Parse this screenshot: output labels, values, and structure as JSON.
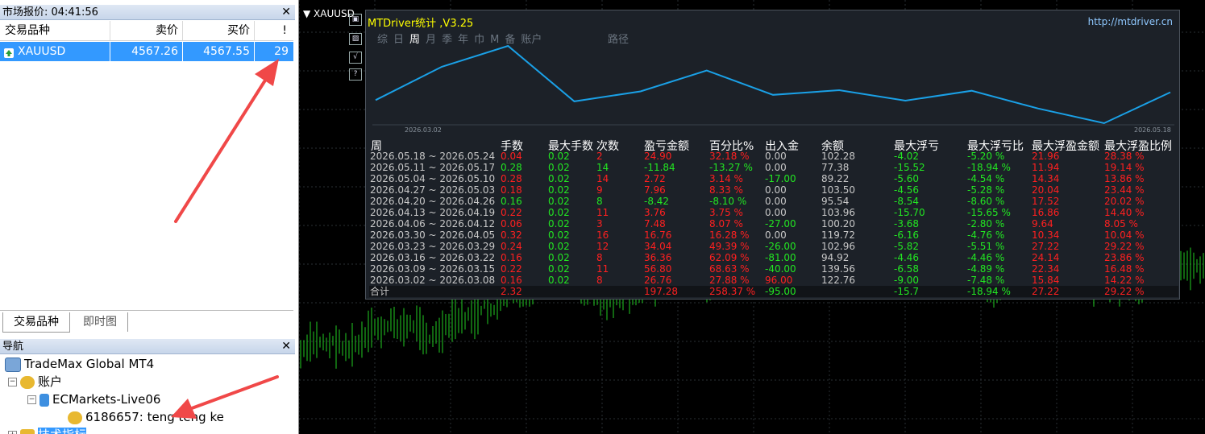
{
  "market_watch": {
    "title": "市场报价: 04:41:56",
    "columns": [
      "交易品种",
      "卖价",
      "买价",
      "!"
    ],
    "row": {
      "symbol": "XAUUSD",
      "bid": "4567.26",
      "ask": "4567.55",
      "spread": "29"
    },
    "tabs": [
      "交易品种",
      "即时图"
    ]
  },
  "navigator": {
    "title": "导航",
    "items": [
      "TradeMax Global MT4",
      "账户",
      "ECMarkets-Live06",
      "6186657: teng teng ke",
      "技术指标"
    ]
  },
  "chart": {
    "symbol": "XAUUSD"
  },
  "stats": {
    "title": "MTDriver统计 ,V3.25",
    "url": "http://mtdriver.cn",
    "tabs": [
      "综",
      "日",
      "周",
      "月",
      "季",
      "年",
      "巾",
      "M",
      "备",
      "账户"
    ],
    "route": "路径",
    "side_icons": [
      "▣",
      "▨",
      "√",
      "?"
    ],
    "chart_x_start": "2026.03.02",
    "chart_x_end": "2026.05.18",
    "headers": [
      "周",
      "手数",
      "最大手数",
      "次数",
      "盈亏金额",
      "百分比%",
      "出入金",
      "余额",
      "最大浮亏",
      "最大浮亏比",
      "最大浮盈金额",
      "最大浮盈比例"
    ],
    "rows": [
      [
        "2026.05.18 ~ 2026.05.24",
        "0.04",
        "0.02",
        "2",
        "24.90",
        "32.18 %",
        "0.00",
        "102.28",
        "-4.02",
        "-5.20 %",
        "21.96",
        "28.38 %"
      ],
      [
        "2026.05.11 ~ 2026.05.17",
        "0.28",
        "0.02",
        "14",
        "-11.84",
        "-13.27 %",
        "0.00",
        "77.38",
        "-15.52",
        "-18.94 %",
        "11.94",
        "19.14 %"
      ],
      [
        "2026.05.04 ~ 2026.05.10",
        "0.28",
        "0.02",
        "14",
        "2.72",
        "3.14 %",
        "-17.00",
        "89.22",
        "-5.60",
        "-4.54 %",
        "14.34",
        "13.86 %"
      ],
      [
        "2026.04.27 ~ 2026.05.03",
        "0.18",
        "0.02",
        "9",
        "7.96",
        "8.33 %",
        "0.00",
        "103.50",
        "-4.56",
        "-5.28 %",
        "20.04",
        "23.44 %"
      ],
      [
        "2026.04.20 ~ 2026.04.26",
        "0.16",
        "0.02",
        "8",
        "-8.42",
        "-8.10 %",
        "0.00",
        "95.54",
        "-8.54",
        "-8.60 %",
        "17.52",
        "20.02 %"
      ],
      [
        "2026.04.13 ~ 2026.04.19",
        "0.22",
        "0.02",
        "11",
        "3.76",
        "3.75 %",
        "0.00",
        "103.96",
        "-15.70",
        "-15.65 %",
        "16.86",
        "14.40 %"
      ],
      [
        "2026.04.06 ~ 2026.04.12",
        "0.06",
        "0.02",
        "3",
        "7.48",
        "8.07 %",
        "-27.00",
        "100.20",
        "-3.68",
        "-2.80 %",
        "9.64",
        "8.05 %"
      ],
      [
        "2026.03.30 ~ 2026.04.05",
        "0.32",
        "0.02",
        "16",
        "16.76",
        "16.28 %",
        "0.00",
        "119.72",
        "-6.16",
        "-4.76 %",
        "10.34",
        "10.04 %"
      ],
      [
        "2026.03.23 ~ 2026.03.29",
        "0.24",
        "0.02",
        "12",
        "34.04",
        "49.39 %",
        "-26.00",
        "102.96",
        "-5.82",
        "-5.51 %",
        "27.22",
        "29.22 %"
      ],
      [
        "2026.03.16 ~ 2026.03.22",
        "0.16",
        "0.02",
        "8",
        "36.36",
        "62.09 %",
        "-81.00",
        "94.92",
        "-4.46",
        "-4.46 %",
        "24.14",
        "23.86 %"
      ],
      [
        "2026.03.09 ~ 2026.03.15",
        "0.22",
        "0.02",
        "11",
        "56.80",
        "68.63 %",
        "-40.00",
        "139.56",
        "-6.58",
        "-4.89 %",
        "22.34",
        "16.48 %"
      ],
      [
        "2026.03.02 ~ 2026.03.08",
        "0.16",
        "0.02",
        "8",
        "26.76",
        "27.88 %",
        "96.00",
        "122.76",
        "-9.00",
        "-7.48 %",
        "15.84",
        "14.22 %"
      ]
    ],
    "total": [
      "合计",
      "2.32",
      "",
      "",
      "197.28",
      "258.37 %",
      "-95.00",
      "",
      "-15.7",
      "-18.94 %",
      "27.22",
      "29.22 %"
    ]
  },
  "colors": {
    "positive": "#ff2020",
    "negative": "#22e622",
    "neutral": "#c8c8c8",
    "title": "#ffff00",
    "equity_line": "#1aa0e6",
    "candles": "#22cc22",
    "annotation_arrow": "#f04848",
    "selection": "#3399ff"
  }
}
